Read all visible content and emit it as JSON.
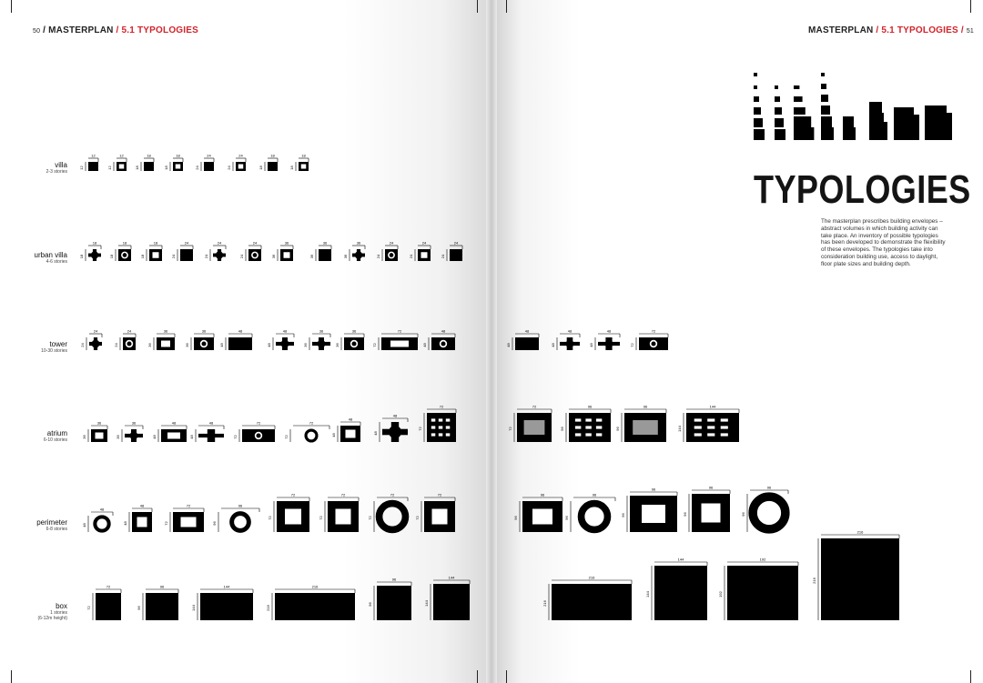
{
  "header_left": {
    "page_num": "50",
    "sep1": " / ",
    "section": "MASTERPLAN",
    "sep2": " / ",
    "subsection": "5.1 TYPOLOGIES"
  },
  "header_right": {
    "section": "MASTERPLAN",
    "sep1": " / ",
    "subsection": "5.1 TYPOLOGIES",
    "sep2": " / ",
    "page_num": "51"
  },
  "title": "TYPOLOGIES",
  "body_text": "The masterplan prescribes building envelopes – abstract volumes in which building activity can take place. An inventory of possible typologies has been developed to demonstrate the flexibility of these envelopes. The typologies take into consideration building use, access to daylight, floor plate sizes and building depth.",
  "colors": {
    "accent": "#d2232a",
    "ink": "#000000"
  },
  "rows": [
    {
      "label": "villa",
      "sub": "2-3 stories"
    },
    {
      "label": "urban villa",
      "sub": "4-6 stories"
    },
    {
      "label": "tower",
      "sub": "10-30 stories"
    },
    {
      "label": "atrium",
      "sub": "6-10 stories"
    },
    {
      "label": "perimeter",
      "sub": "6-8 stories"
    },
    {
      "label": "box",
      "sub": "1 stories",
      "sub2": "(6-12m height)"
    }
  ],
  "dims": {
    "villa": [
      "12",
      "12",
      "18",
      "18",
      "24",
      "24",
      "18",
      "18"
    ],
    "urban_villa": [
      "18",
      "18",
      "18",
      "24",
      "24",
      "24",
      "36",
      "36",
      "36",
      "24",
      "24",
      "24"
    ],
    "tower": [
      "24",
      "24",
      "36",
      "36",
      "48",
      "48",
      "36",
      "36",
      "72",
      "48",
      "48",
      "48",
      "48",
      "72"
    ],
    "atrium": [
      "36",
      "36",
      "48",
      "48",
      "72",
      "72",
      "48",
      "48",
      "72",
      "72",
      "96",
      "96",
      "144"
    ],
    "perimeter": [
      "48",
      "48",
      "72",
      "96",
      "72",
      "72",
      "72",
      "72",
      "96",
      "96",
      "96",
      "96",
      "96"
    ],
    "box": [
      "72",
      "96",
      "144",
      "216",
      "96",
      "144",
      "216",
      "144",
      "192",
      "216"
    ]
  }
}
